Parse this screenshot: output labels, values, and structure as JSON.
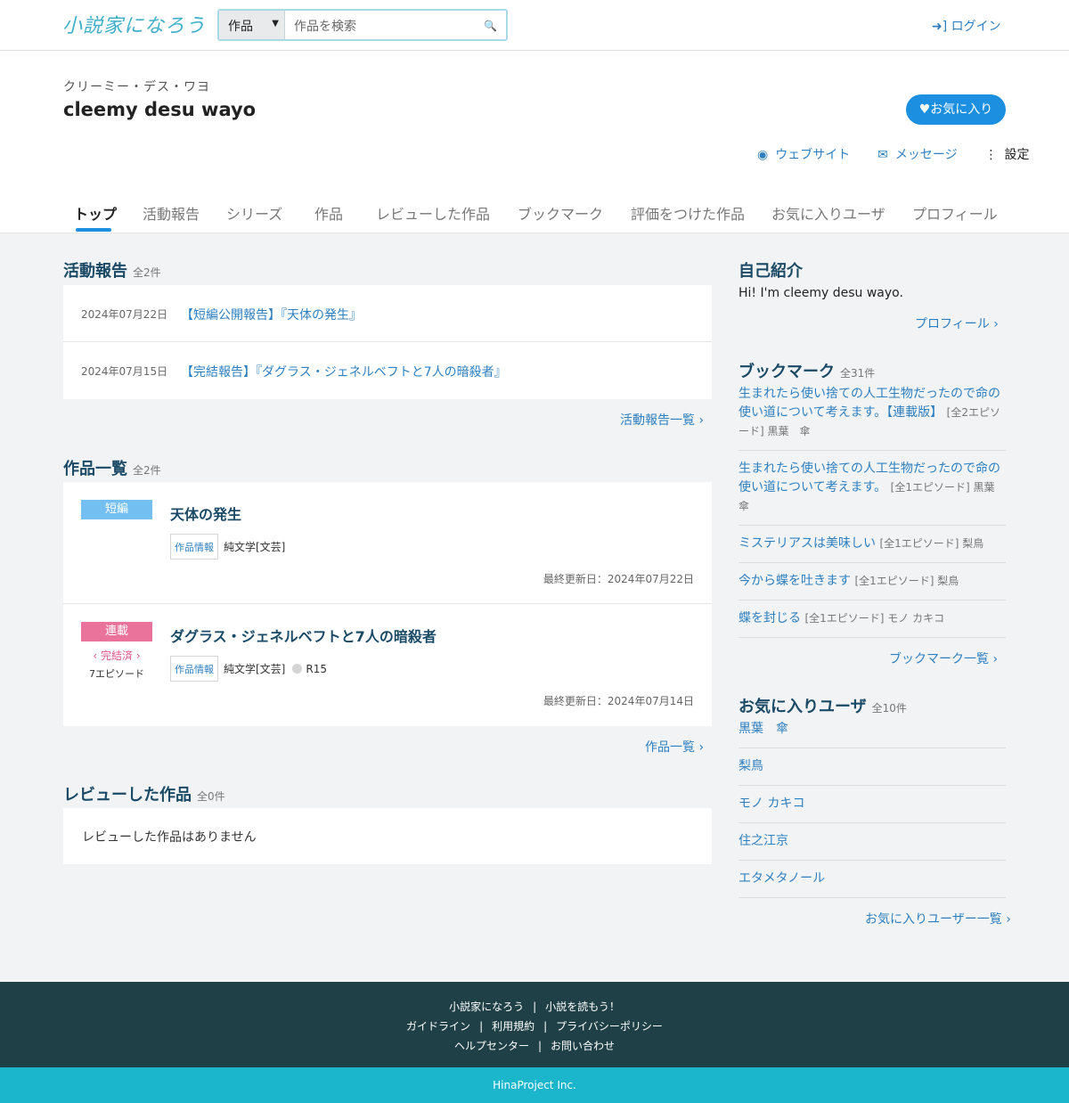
{
  "header": {
    "logo": "小説家になろう",
    "search_select": "作品",
    "search_placeholder": "作品を検索",
    "login": "ログイン"
  },
  "profile": {
    "kana": "クリーミー・デス・ワヨ",
    "name": "cleemy desu wayo",
    "fav_button": "♥お気に入り",
    "website": "ウェブサイト",
    "message": "メッセージ",
    "settings": "設定"
  },
  "tabs": [
    "トップ",
    "活動報告",
    "シリーズ",
    "作品",
    "レビューした作品",
    "ブックマーク",
    "評価をつけた作品",
    "お気に入りユーザ",
    "プロフィール"
  ],
  "reports": {
    "title": "活動報告",
    "count": "全2件",
    "items": [
      {
        "date": "2024年07月22日",
        "title": "【短編公開報告】『天体の発生』"
      },
      {
        "date": "2024年07月15日",
        "title": "【完結報告】『ダグラス・ジェネルベフトと7人の暗殺者』"
      }
    ],
    "more": "活動報告一覧"
  },
  "works": {
    "title": "作品一覧",
    "count": "全2件",
    "items": [
      {
        "type": "短編",
        "title": "天体の発生",
        "info": "作品情報",
        "genre": "純文学[文芸]",
        "updated": "最終更新日：2024年07月22日"
      },
      {
        "type": "連載",
        "status": "完結済",
        "episodes": "7エピソード",
        "title": "ダグラス・ジェネルベフトと7人の暗殺者",
        "info": "作品情報",
        "genre": "純文学[文芸]",
        "rating": "R15",
        "updated": "最終更新日：2024年07月14日"
      }
    ],
    "more": "作品一覧"
  },
  "reviews": {
    "title": "レビューした作品",
    "count": "全0件",
    "empty": "レビューした作品はありません"
  },
  "sidebar": {
    "intro_title": "自己紹介",
    "intro_text": "Hi! I'm cleemy desu wayo.",
    "profile_link": "プロフィール",
    "bookmarks_title": "ブックマーク",
    "bookmarks_count": "全31件",
    "bookmarks": [
      {
        "title": "生まれたら使い捨ての人工生物だったので命の使い道について考えます。【連載版】",
        "meta": "[全2エピソード] 黒葉　傘"
      },
      {
        "title": "生まれたら使い捨ての人工生物だったので命の使い道について考えます。",
        "meta": "[全1エピソード] 黒葉　傘"
      },
      {
        "title": "ミステリアスは美味しい",
        "meta": "[全1エピソード] 梨鳥"
      },
      {
        "title": "今から蝶を吐きます",
        "meta": "[全1エピソード] 梨鳥"
      },
      {
        "title": "蝶を封じる",
        "meta": "[全1エピソード] モノ カキコ"
      }
    ],
    "bookmarks_more": "ブックマーク一覧",
    "fav_users_title": "お気に入りユーザ",
    "fav_users_count": "全10件",
    "fav_users": [
      "黒葉　傘",
      "梨鳥",
      "モノ カキコ",
      "住之江京",
      "エタメタノール"
    ],
    "fav_users_more": "お気に入りユーザー一覧"
  },
  "footer": {
    "row1": [
      "小説家になろう",
      "小説を読もう！"
    ],
    "row2": [
      "ガイドライン",
      "利用規約",
      "プライバシーポリシー"
    ],
    "row3": [
      "ヘルプセンター",
      "お問い合わせ"
    ],
    "copyright": "HinaProject Inc."
  },
  "colors": {
    "accent": "#1d8fe0",
    "short_badge": "#74bff2",
    "serial_badge": "#e9739b",
    "footer": "#1f4046",
    "copyright_bar": "#1bb5cc"
  }
}
